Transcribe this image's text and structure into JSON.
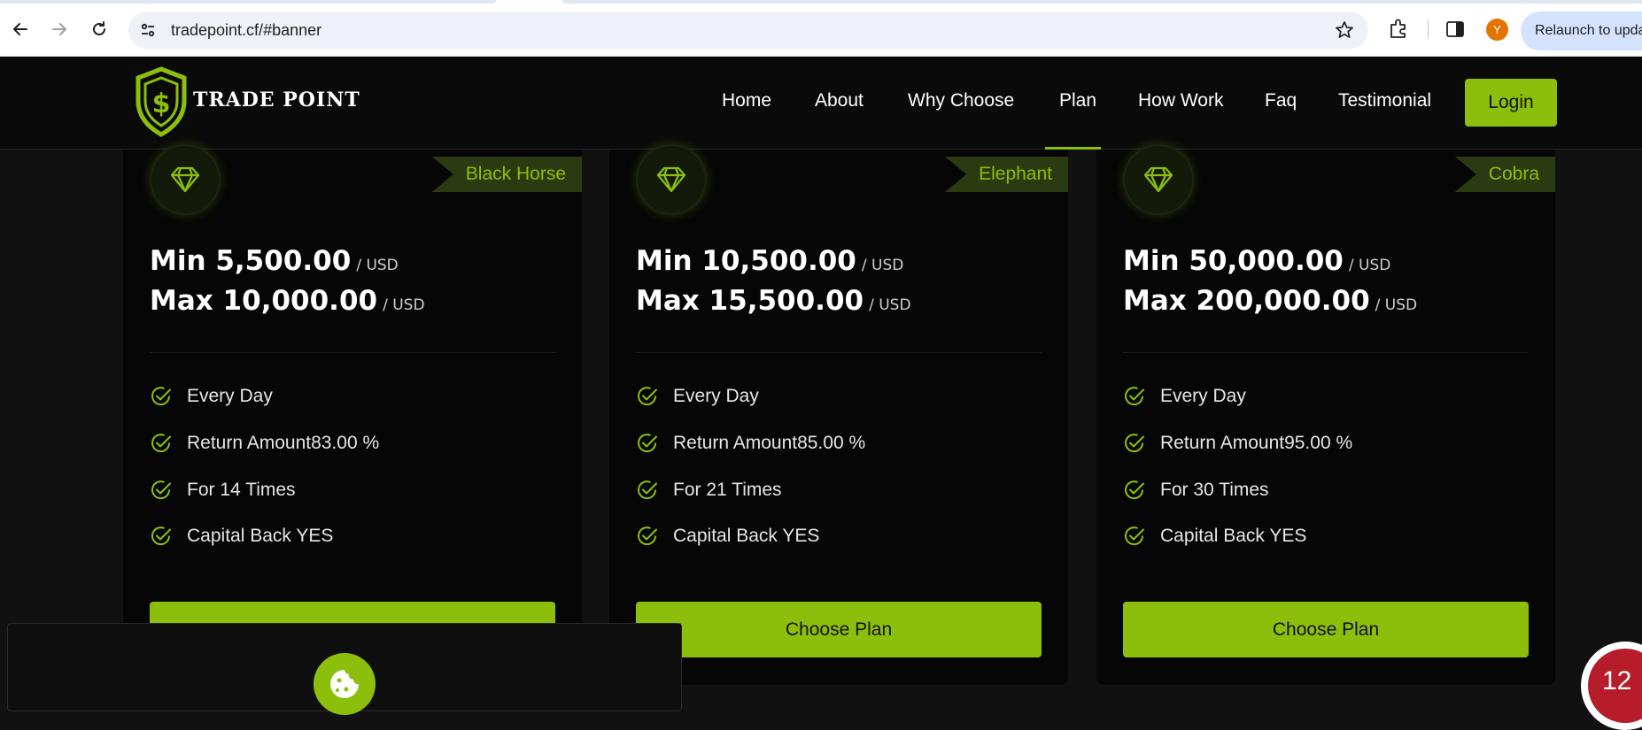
{
  "browser": {
    "url": "tradepoint.cf/#banner",
    "avatar_initial": "Y",
    "relaunch_label": "Relaunch to upda"
  },
  "site": {
    "logo_text": "TRADE POINT",
    "nav": [
      "Home",
      "About",
      "Why Choose",
      "Plan",
      "How Work",
      "Faq",
      "Testimonial"
    ],
    "active_nav": "Plan",
    "login_label": "Login",
    "accent_color": "#8cbf0b"
  },
  "plans": [
    {
      "name": "Black Horse",
      "min": "Min 5,500.00",
      "max": "Max 10,000.00",
      "unit": "/ USD",
      "features": [
        "Every Day",
        "Return Amount83.00 %",
        "For 14 Times",
        "Capital Back YES"
      ],
      "button": ""
    },
    {
      "name": "Elephant",
      "min": "Min 10,500.00",
      "max": "Max 15,500.00",
      "unit": "/ USD",
      "features": [
        "Every Day",
        "Return Amount85.00 %",
        "For 21 Times",
        "Capital Back YES"
      ],
      "button": "Choose Plan"
    },
    {
      "name": "Cobra",
      "min": "Min 50,000.00",
      "max": "Max 200,000.00",
      "unit": "/ USD",
      "features": [
        "Every Day",
        "Return Amount95.00 %",
        "For 30 Times",
        "Capital Back YES"
      ],
      "button": "Choose Plan"
    }
  ],
  "floating_badge": "12"
}
